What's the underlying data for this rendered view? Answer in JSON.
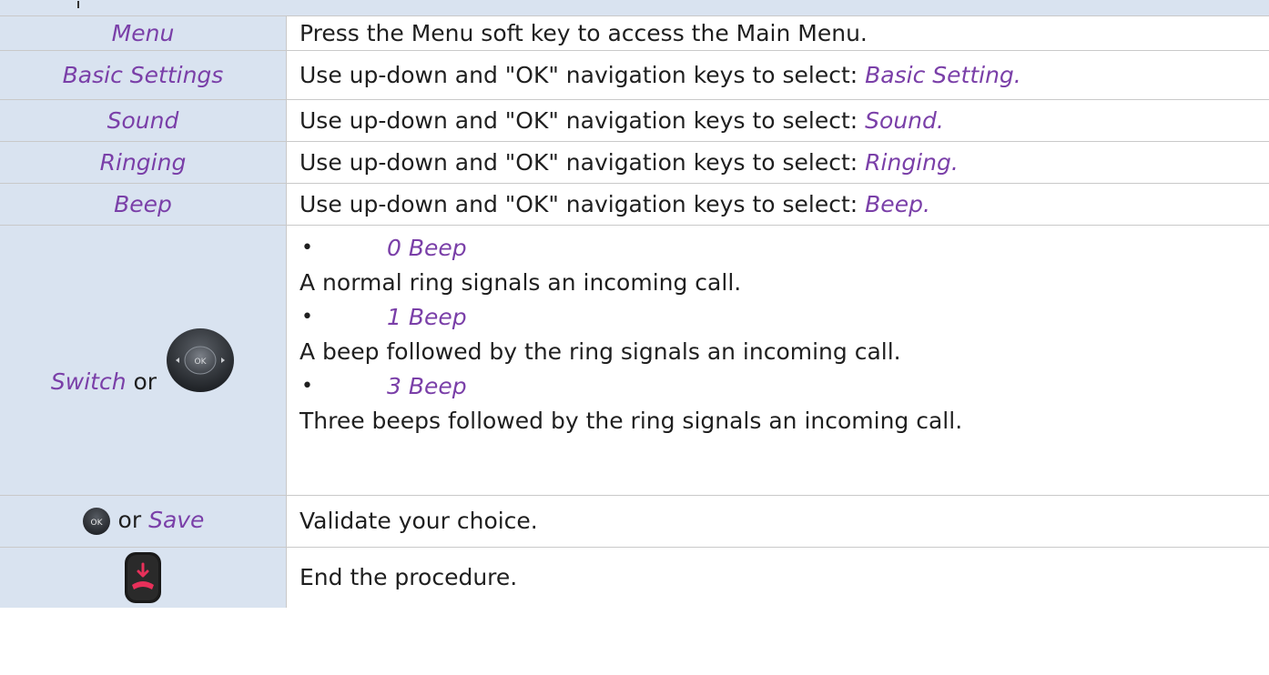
{
  "rows": [
    {
      "key": "Menu",
      "desc": "Press the Menu soft key to access the Main Menu."
    },
    {
      "key": "Basic Settings",
      "desc_prefix": "Use up-down and \"OK\" navigation keys to select: ",
      "desc_item": "Basic Setting."
    },
    {
      "key": "Sound",
      "desc_prefix": "Use up-down and \"OK\" navigation keys to select: ",
      "desc_item": "Sound."
    },
    {
      "key": "Ringing",
      "desc_prefix": "Use up-down and \"OK\" navigation keys to select: ",
      "desc_item": "Ringing."
    },
    {
      "key": "Beep",
      "desc_prefix": "Use up-down and \"OK\" navigation keys to select: ",
      "desc_item": "Beep."
    }
  ],
  "switch_row": {
    "key": "Switch",
    "or": "or",
    "navpad_label": "OK",
    "options": [
      {
        "bullet": "•",
        "name": "0 Beep",
        "desc": "A normal ring signals an incoming call."
      },
      {
        "bullet": "•",
        "name": "1 Beep",
        "desc": "A beep followed by the ring signals an incoming call."
      },
      {
        "bullet": "•",
        "name": "3 Beep",
        "desc": "Three beeps followed by the ring signals an incoming call."
      }
    ]
  },
  "save_row": {
    "ok_label": "OK",
    "or": "or",
    "save": "Save",
    "desc": "Validate your choice."
  },
  "end_row": {
    "desc": "End the procedure."
  },
  "icons": {
    "navpad": "navigation-pad-icon",
    "ok": "ok-key-icon",
    "hangup": "hang-up-key-icon"
  },
  "colors": {
    "accent_text": "#7a3fa8",
    "left_column_bg": "#d9e3f0",
    "hangup_key": "#e8305a"
  }
}
